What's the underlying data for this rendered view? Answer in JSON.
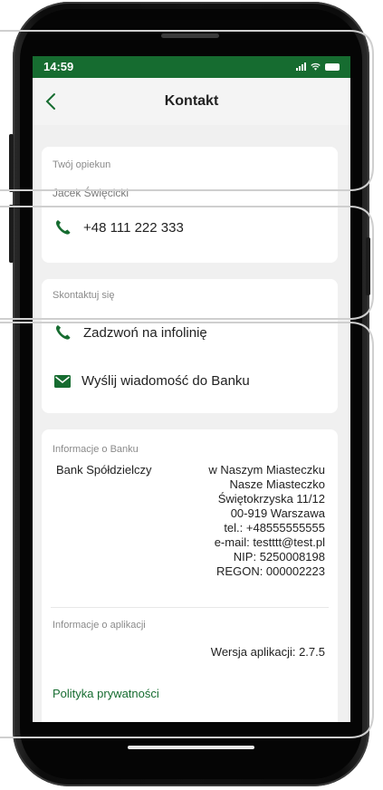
{
  "statusbar": {
    "time": "14:59"
  },
  "header": {
    "title": "Kontakt"
  },
  "advisor": {
    "label": "Twój opiekun",
    "name": "Jacek Święcicki",
    "phone": "+48 111 222 333"
  },
  "contact": {
    "label": "Skontaktuj się",
    "call": "Zadzwoń na infolinię",
    "message": "Wyślij wiadomość do Banku"
  },
  "bank_info": {
    "label": "Informacje o Banku",
    "name": "Bank Spółdzielczy",
    "lines": [
      "w Naszym Miasteczku",
      "Nasze Miasteczko",
      "Świętokrzyska 11/12",
      "00-919 Warszawa",
      "tel.: +48555555555",
      "e-mail: testttt@test.pl",
      "NIP: 5250008198",
      "REGON: 000002223"
    ]
  },
  "app_info": {
    "label": "Informacje o aplikacji",
    "version": "Wersja aplikacji: 2.7.5"
  },
  "privacy_link": "Polityka prywatności",
  "colors": {
    "accent": "#166c30",
    "background": "#f0f0f0",
    "card": "#ffffff"
  }
}
